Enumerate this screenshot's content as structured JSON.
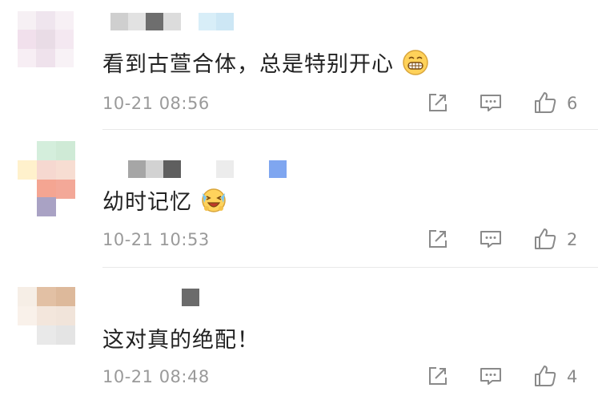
{
  "comments": [
    {
      "text": "看到古萱合体，总是特别开心",
      "time": "10-21 08:56",
      "likes": "6",
      "emoji": "grinning-face-icon"
    },
    {
      "text": "幼时记忆",
      "time": "10-21 10:53",
      "likes": "2",
      "emoji": "crying-laughing-face-icon"
    },
    {
      "text": "这对真的绝配！",
      "time": "10-21 08:48",
      "likes": "4"
    }
  ],
  "icons": {
    "share": "share-icon",
    "comment": "comment-icon",
    "like": "thumbs-up-icon"
  },
  "colors": {
    "text": "#222222",
    "meta": "#9a9a9a",
    "icon": "#8a8a8a",
    "divider": "#e9e9e9"
  }
}
